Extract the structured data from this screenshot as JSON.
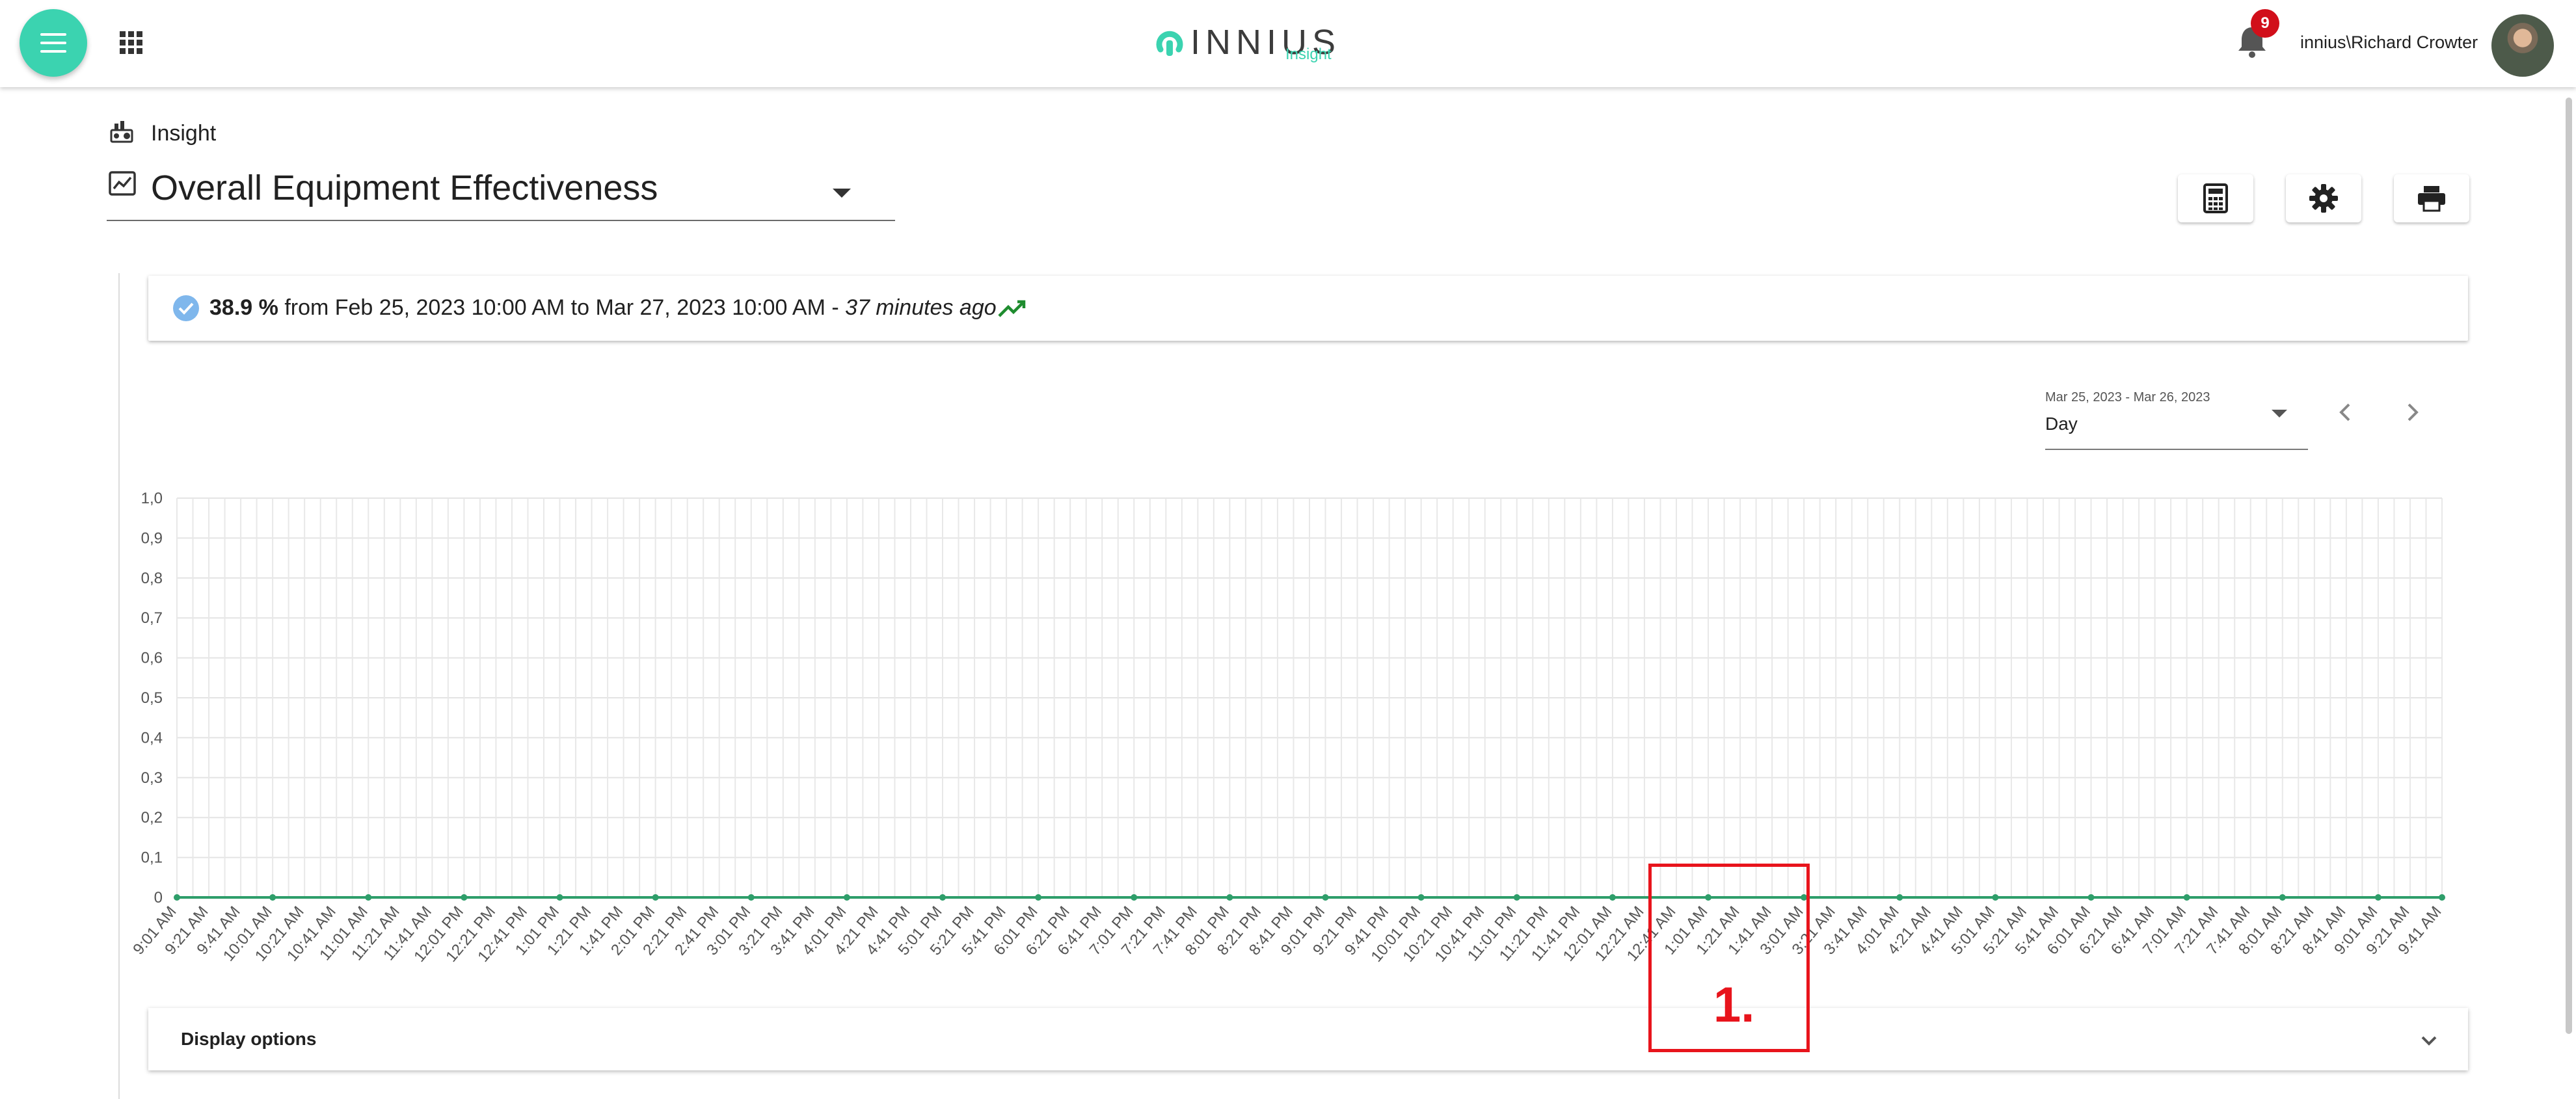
{
  "header": {
    "logo_word": "INNIUS",
    "logo_sub": "Insight",
    "notification_count": "9",
    "username": "innius\\Richard Crowter",
    "brand_color": "#3bd3b0"
  },
  "breadcrumb": {
    "label": "Insight"
  },
  "kpi_selector": {
    "value": "Overall Equipment Effectiveness"
  },
  "toolbar": {
    "calculator_icon": "calculator-icon",
    "settings_icon": "gear-icon",
    "print_icon": "print-icon"
  },
  "summary": {
    "percent": "38.9 %",
    "range_text": "from Feb 25, 2023 10:00 AM to Mar 27, 2023 10:00 AM -",
    "ago": "37 minutes ago",
    "trend_icon": "trending-up-icon",
    "trend_color": "#1e8c2e"
  },
  "period": {
    "range": "Mar 25, 2023 - Mar 26, 2023",
    "value": "Day"
  },
  "chart_data": {
    "type": "line",
    "ylim": [
      0,
      1
    ],
    "y_ticks": [
      "1,0",
      "0,9",
      "0,8",
      "0,7",
      "0,6",
      "0,5",
      "0,4",
      "0,3",
      "0,2",
      "0,1",
      "0"
    ],
    "grid": true,
    "line_color": "#2e9e6a",
    "categories": [
      "9:01 AM",
      "9:21 AM",
      "9:41 AM",
      "10:01 AM",
      "10:21 AM",
      "10:41 AM",
      "11:01 AM",
      "11:21 AM",
      "11:41 AM",
      "12:01 PM",
      "12:21 PM",
      "12:41 PM",
      "1:01 PM",
      "1:21 PM",
      "1:41 PM",
      "2:01 PM",
      "2:21 PM",
      "2:41 PM",
      "3:01 PM",
      "3:21 PM",
      "3:41 PM",
      "4:01 PM",
      "4:21 PM",
      "4:41 PM",
      "5:01 PM",
      "5:21 PM",
      "5:41 PM",
      "6:01 PM",
      "6:21 PM",
      "6:41 PM",
      "7:01 PM",
      "7:21 PM",
      "7:41 PM",
      "8:01 PM",
      "8:21 PM",
      "8:41 PM",
      "9:01 PM",
      "9:21 PM",
      "9:41 PM",
      "10:01 PM",
      "10:21 PM",
      "10:41 PM",
      "11:01 PM",
      "11:21 PM",
      "11:41 PM",
      "12:01 AM",
      "12:21 AM",
      "12:41 AM",
      "1:01 AM",
      "1:21 AM",
      "1:41 AM",
      "3:01 AM",
      "3:21 AM",
      "3:41 AM",
      "4:01 AM",
      "4:21 AM",
      "4:41 AM",
      "5:01 AM",
      "5:21 AM",
      "5:41 AM",
      "6:01 AM",
      "6:21 AM",
      "6:41 AM",
      "7:01 AM",
      "7:21 AM",
      "7:41 AM",
      "8:01 AM",
      "8:21 AM",
      "8:41 AM",
      "9:01 AM",
      "9:21 AM",
      "9:41 AM"
    ],
    "values": [
      0,
      0,
      0,
      0,
      0,
      0,
      0,
      0,
      0,
      0,
      0,
      0,
      0,
      0,
      0,
      0,
      0,
      0,
      0,
      0,
      0,
      0,
      0,
      0,
      0,
      0,
      0,
      0,
      0,
      0,
      0,
      0,
      0,
      0,
      0,
      0,
      0,
      0,
      0,
      0,
      0,
      0,
      0,
      0,
      0,
      0,
      0,
      0,
      0,
      0,
      0,
      0,
      0,
      0,
      0,
      0,
      0,
      0,
      0,
      0,
      0,
      0,
      0,
      0,
      0,
      0,
      0,
      0,
      0,
      0,
      0,
      0
    ]
  },
  "display_options": {
    "label": "Display options"
  },
  "annotation": {
    "label": "1.",
    "color": "#e8141c"
  }
}
